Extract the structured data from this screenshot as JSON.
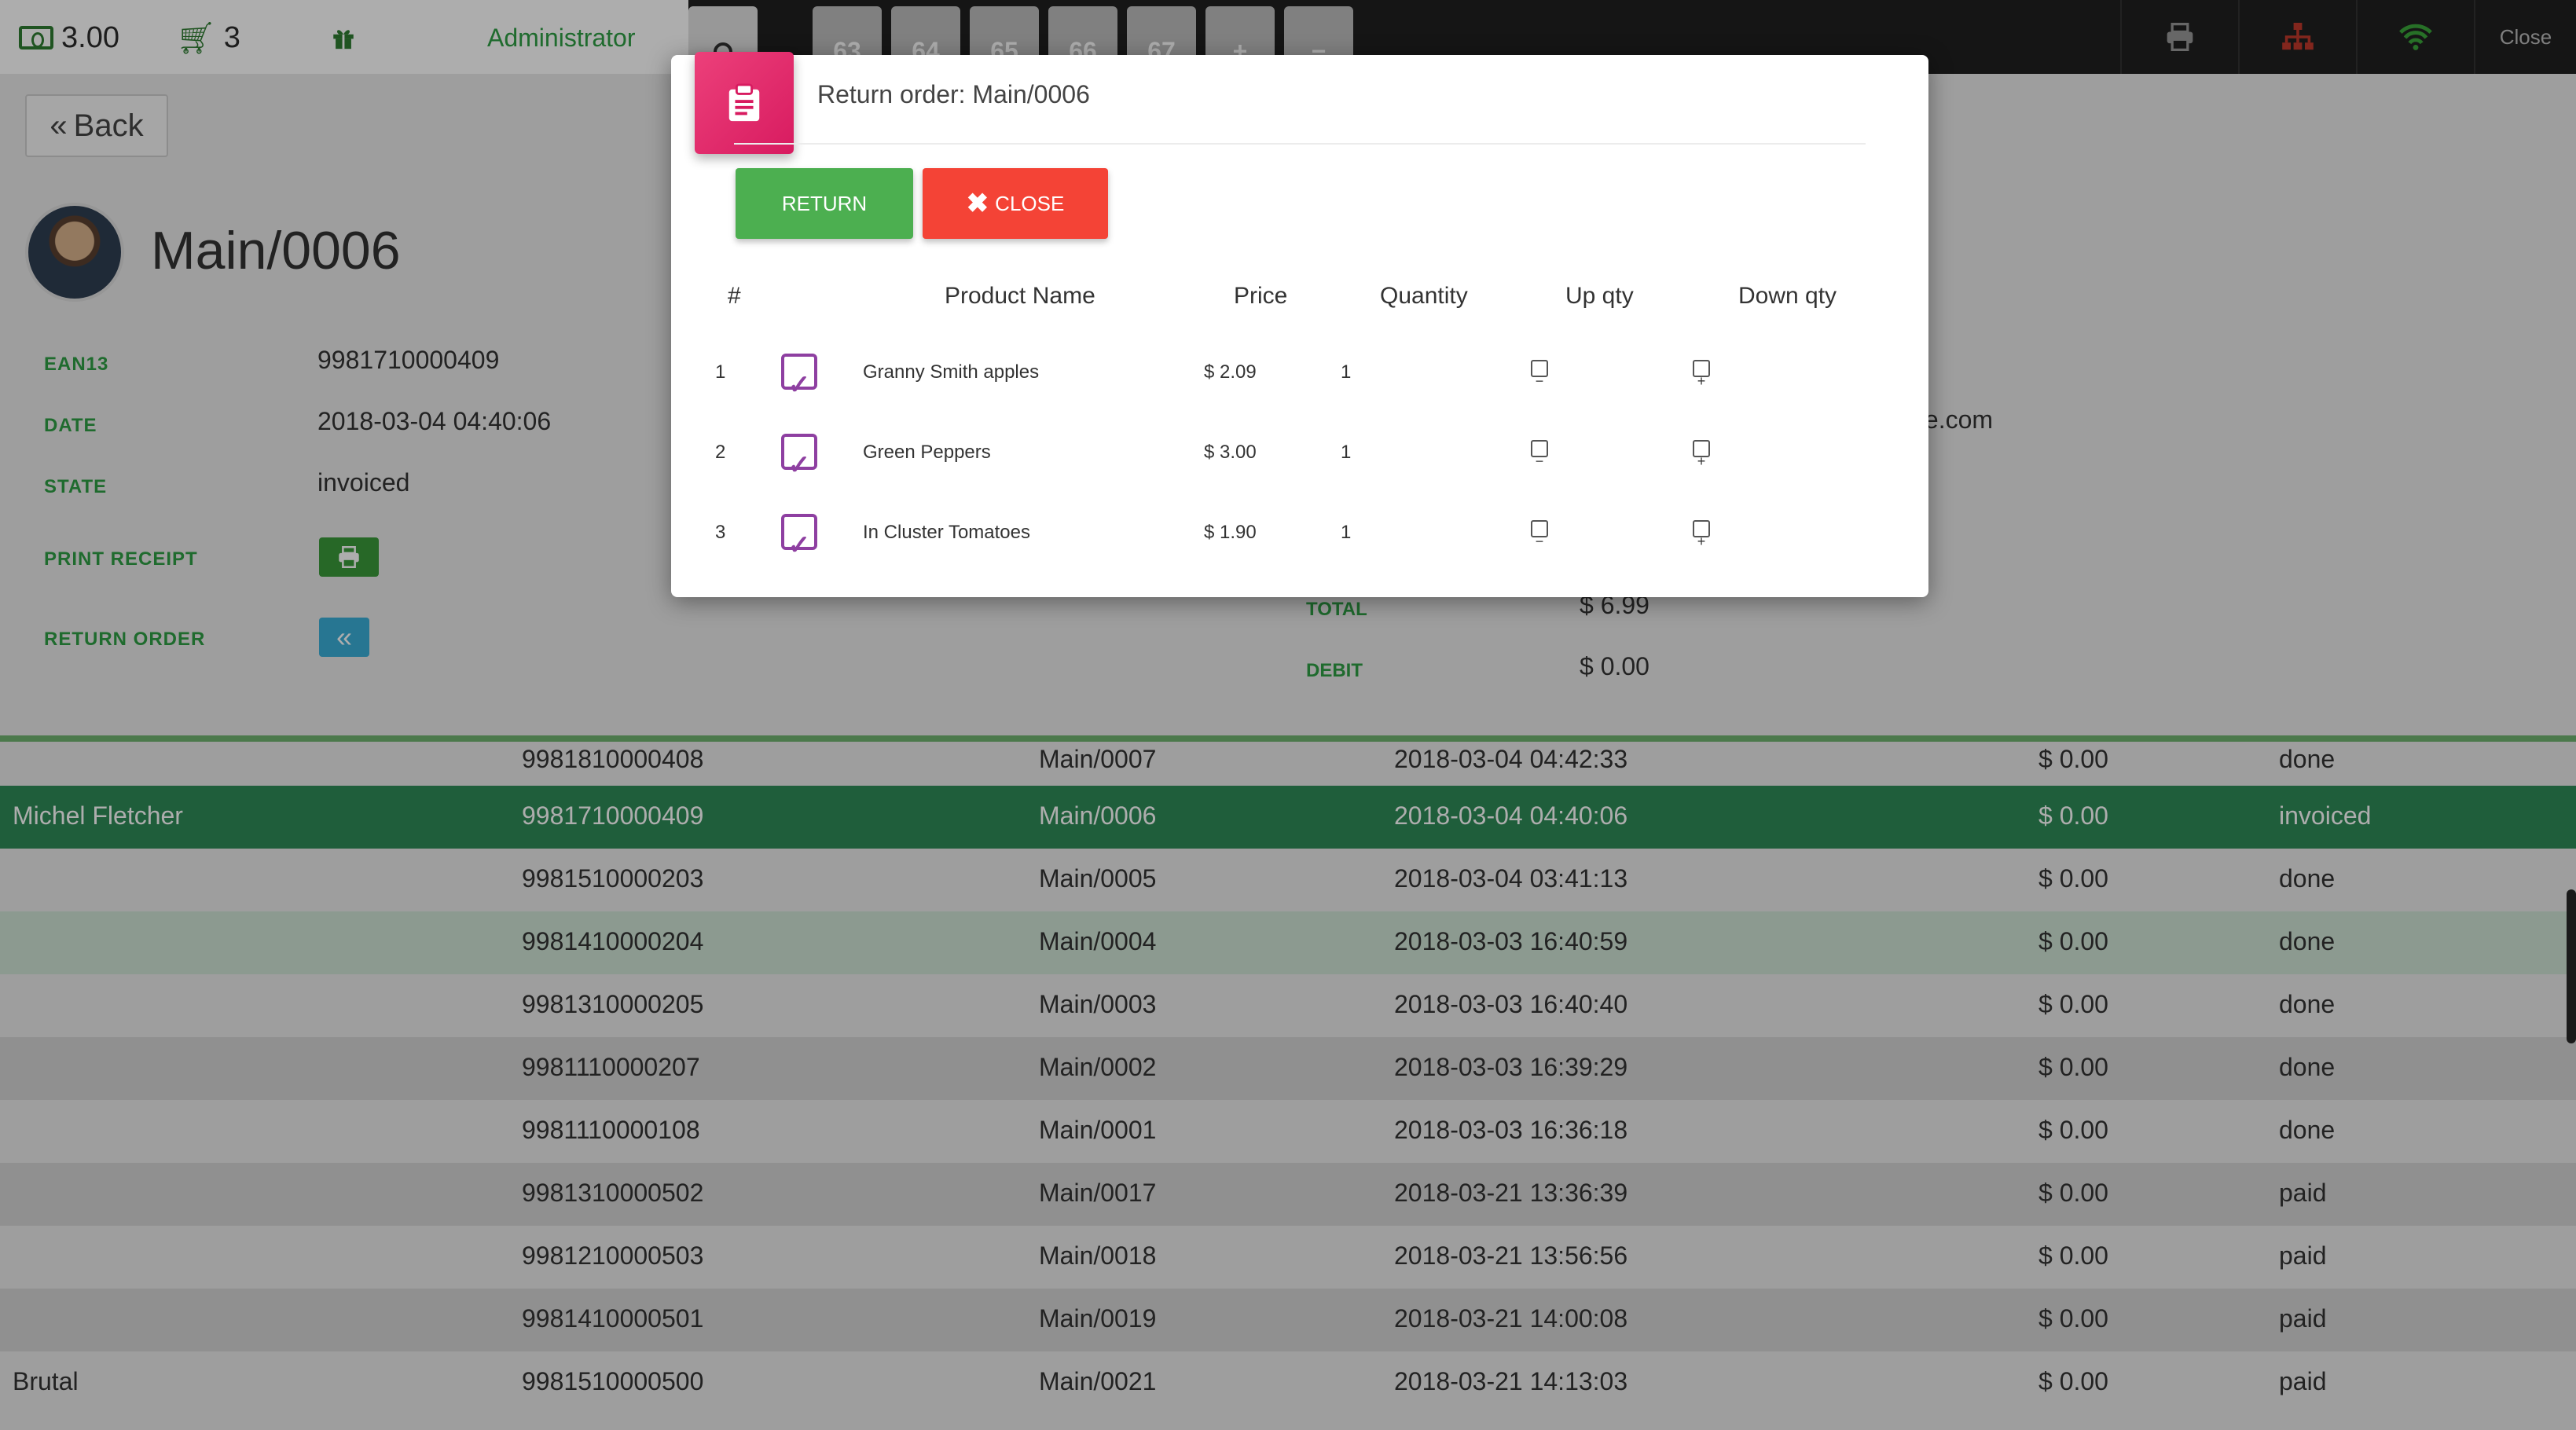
{
  "topbar": {
    "money": "3.00",
    "cart_count": "3",
    "user": "Administrator",
    "order_tabs": [
      "63",
      "64",
      "65",
      "66",
      "67"
    ],
    "add_order": "+",
    "remove_order": "−",
    "close_label": "Close"
  },
  "page": {
    "back_label": "Back",
    "order_name": "Main/0006",
    "fields": {
      "ean13_label": "EAN13",
      "ean13_value": "9981710000409",
      "date_label": "DATE",
      "date_value": "2018-03-04 04:40:06",
      "state_label": "STATE",
      "state_value": "invoiced",
      "print_label": "PRINT RECEIPT",
      "return_label": "RETURN ORDER"
    },
    "email_fragment": "ple.com",
    "total_label": "TOTAL",
    "total_value": "$ 6.99",
    "debit_label": "DEBIT",
    "debit_value": "$ 0.00"
  },
  "orders": [
    {
      "customer": "",
      "ean": "9981810000408",
      "ref": "Main/0007",
      "date": "2018-03-04 04:42:33",
      "amount": "$ 0.00",
      "state": "done"
    },
    {
      "customer": "Michel Fletcher",
      "ean": "9981710000409",
      "ref": "Main/0006",
      "date": "2018-03-04 04:40:06",
      "amount": "$ 0.00",
      "state": "invoiced"
    },
    {
      "customer": "",
      "ean": "9981510000203",
      "ref": "Main/0005",
      "date": "2018-03-04 03:41:13",
      "amount": "$ 0.00",
      "state": "done"
    },
    {
      "customer": "",
      "ean": "9981410000204",
      "ref": "Main/0004",
      "date": "2018-03-03 16:40:59",
      "amount": "$ 0.00",
      "state": "done"
    },
    {
      "customer": "",
      "ean": "9981310000205",
      "ref": "Main/0003",
      "date": "2018-03-03 16:40:40",
      "amount": "$ 0.00",
      "state": "done"
    },
    {
      "customer": "",
      "ean": "9981110000207",
      "ref": "Main/0002",
      "date": "2018-03-03 16:39:29",
      "amount": "$ 0.00",
      "state": "done"
    },
    {
      "customer": "",
      "ean": "9981110000108",
      "ref": "Main/0001",
      "date": "2018-03-03 16:36:18",
      "amount": "$ 0.00",
      "state": "done"
    },
    {
      "customer": "",
      "ean": "9981310000502",
      "ref": "Main/0017",
      "date": "2018-03-21 13:36:39",
      "amount": "$ 0.00",
      "state": "paid"
    },
    {
      "customer": "",
      "ean": "9981210000503",
      "ref": "Main/0018",
      "date": "2018-03-21 13:56:56",
      "amount": "$ 0.00",
      "state": "paid"
    },
    {
      "customer": "",
      "ean": "9981410000501",
      "ref": "Main/0019",
      "date": "2018-03-21 14:00:08",
      "amount": "$ 0.00",
      "state": "paid"
    },
    {
      "customer": "Brutal",
      "ean": "9981510000500",
      "ref": "Main/0021",
      "date": "2018-03-21 14:13:03",
      "amount": "$ 0.00",
      "state": "paid"
    }
  ],
  "modal": {
    "title": "Return order: Main/0006",
    "return_button": "RETURN",
    "close_button": "CLOSE",
    "headers": {
      "num": "#",
      "product": "Product Name",
      "price": "Price",
      "quantity": "Quantity",
      "up": "Up qty",
      "down": "Down qty"
    },
    "lines": [
      {
        "num": "1",
        "product": "Granny Smith apples",
        "price": "$ 2.09",
        "quantity": "1"
      },
      {
        "num": "2",
        "product": "Green Peppers",
        "price": "$ 3.00",
        "quantity": "1"
      },
      {
        "num": "3",
        "product": "In Cluster Tomatoes",
        "price": "$ 1.90",
        "quantity": "1"
      }
    ]
  },
  "colors": {
    "accent_green": "#4caf50",
    "danger_red": "#f44336",
    "modal_icon_pink": "#d81b60",
    "checkbox_purple": "#8e3fa1",
    "selected_row": "#2e8b57"
  }
}
